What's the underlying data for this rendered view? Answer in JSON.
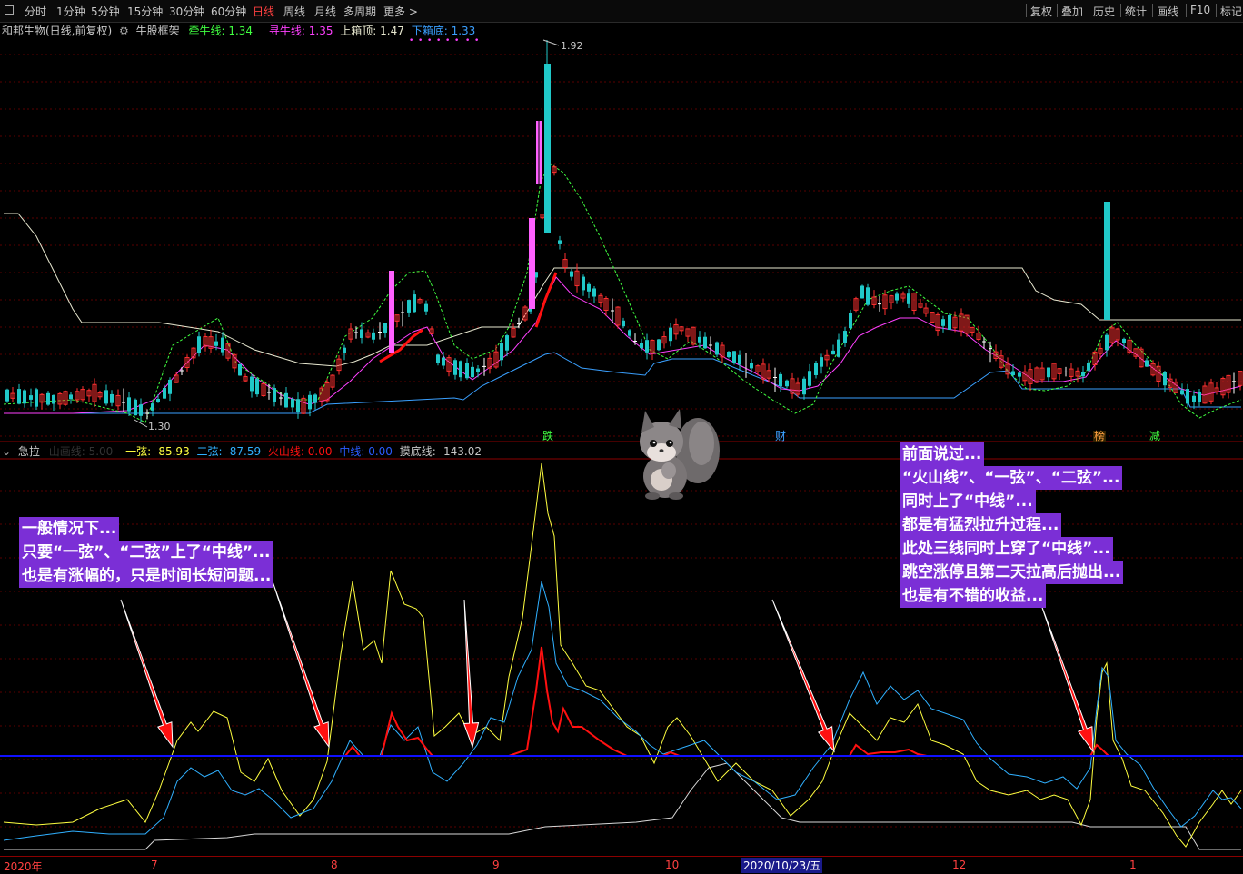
{
  "toolbar": {
    "left": [
      "分时",
      "1分钟",
      "5分钟",
      "15分钟",
      "30分钟",
      "60分钟",
      "日线",
      "周线",
      "月线",
      "多周期",
      "更多 >"
    ],
    "active": "日线",
    "right": [
      "复权",
      "叠加",
      "历史",
      "统计",
      "画线",
      "F10",
      "标记"
    ]
  },
  "main_info": {
    "stock": "和邦生物(日线,前复权)",
    "indicator": "牛股框架",
    "l1_label": "牵牛线:",
    "l1_value": "1.34",
    "l2_label": "寻牛线:",
    "l2_value": "1.35",
    "l3_label": "上箱顶:",
    "l3_value": "1.47",
    "l4_label": "下箱底:",
    "l4_value": "1.33",
    "high_label": "1.92",
    "low_label": "1.30"
  },
  "sub_info": {
    "name": "急拉",
    "param": "山画线: 5.00",
    "s1_label": "一弦:",
    "s1_value": "-85.93",
    "s2_label": "二弦:",
    "s2_value": "-87.59",
    "s3_label": "火山线:",
    "s3_value": "0.00",
    "s4_label": "中线:",
    "s4_value": "0.00",
    "s5_label": "摸底线:",
    "s5_value": "-143.02"
  },
  "markers": [
    "跌",
    "财",
    "榜",
    "减"
  ],
  "annotation_left": [
    "一般情况下...",
    "只要“一弦”、“二弦”上了“中线”...",
    "也是有涨幅的，只是时间长短问题..."
  ],
  "annotation_right": [
    "前面说过...",
    "“火山线”、“一弦”、“二弦”...",
    "同时上了“中线”...",
    "都是有猛烈拉升过程...",
    "此处三线同时上穿了“中线”...",
    "跳空涨停且第二天拉高后抛出...",
    "也是有不错的收益..."
  ],
  "xaxis": {
    "labels": [
      "2020年",
      "7",
      "8",
      "9",
      "10",
      "12",
      "1"
    ],
    "cursor_date": "2020/10/23/五"
  },
  "colors": {
    "up": "#ff3030",
    "down": "#20c8c8",
    "ma_pink": "#ff40ff",
    "ma_green": "#40ff40",
    "box_white": "#e8e8d0",
    "box_blue": "#3aa0ff",
    "yellow": "#ffff40",
    "cyan": "#30b0ff",
    "red_line": "#ff1010",
    "mid_line": "#1010ff",
    "annot_bg": "#7b2fd6"
  },
  "chart_data": [
    {
      "type": "candlestick",
      "title": "和邦生物(日线,前复权)",
      "ylim": [
        1.28,
        1.96
      ],
      "annotations": [
        "1.92",
        "1.30"
      ],
      "series": [
        {
          "name": "牵牛线",
          "last": 1.34
        },
        {
          "name": "寻牛线",
          "last": 1.35
        },
        {
          "name": "上箱顶",
          "last": 1.47
        },
        {
          "name": "下箱底",
          "last": 1.33
        }
      ]
    },
    {
      "type": "line",
      "title": "急拉",
      "series": [
        {
          "name": "一弦",
          "last": -85.93
        },
        {
          "name": "二弦",
          "last": -87.59
        },
        {
          "name": "火山线",
          "last": 0.0
        },
        {
          "name": "中线",
          "last": 0.0
        },
        {
          "name": "摸底线",
          "last": -143.02
        }
      ]
    }
  ]
}
